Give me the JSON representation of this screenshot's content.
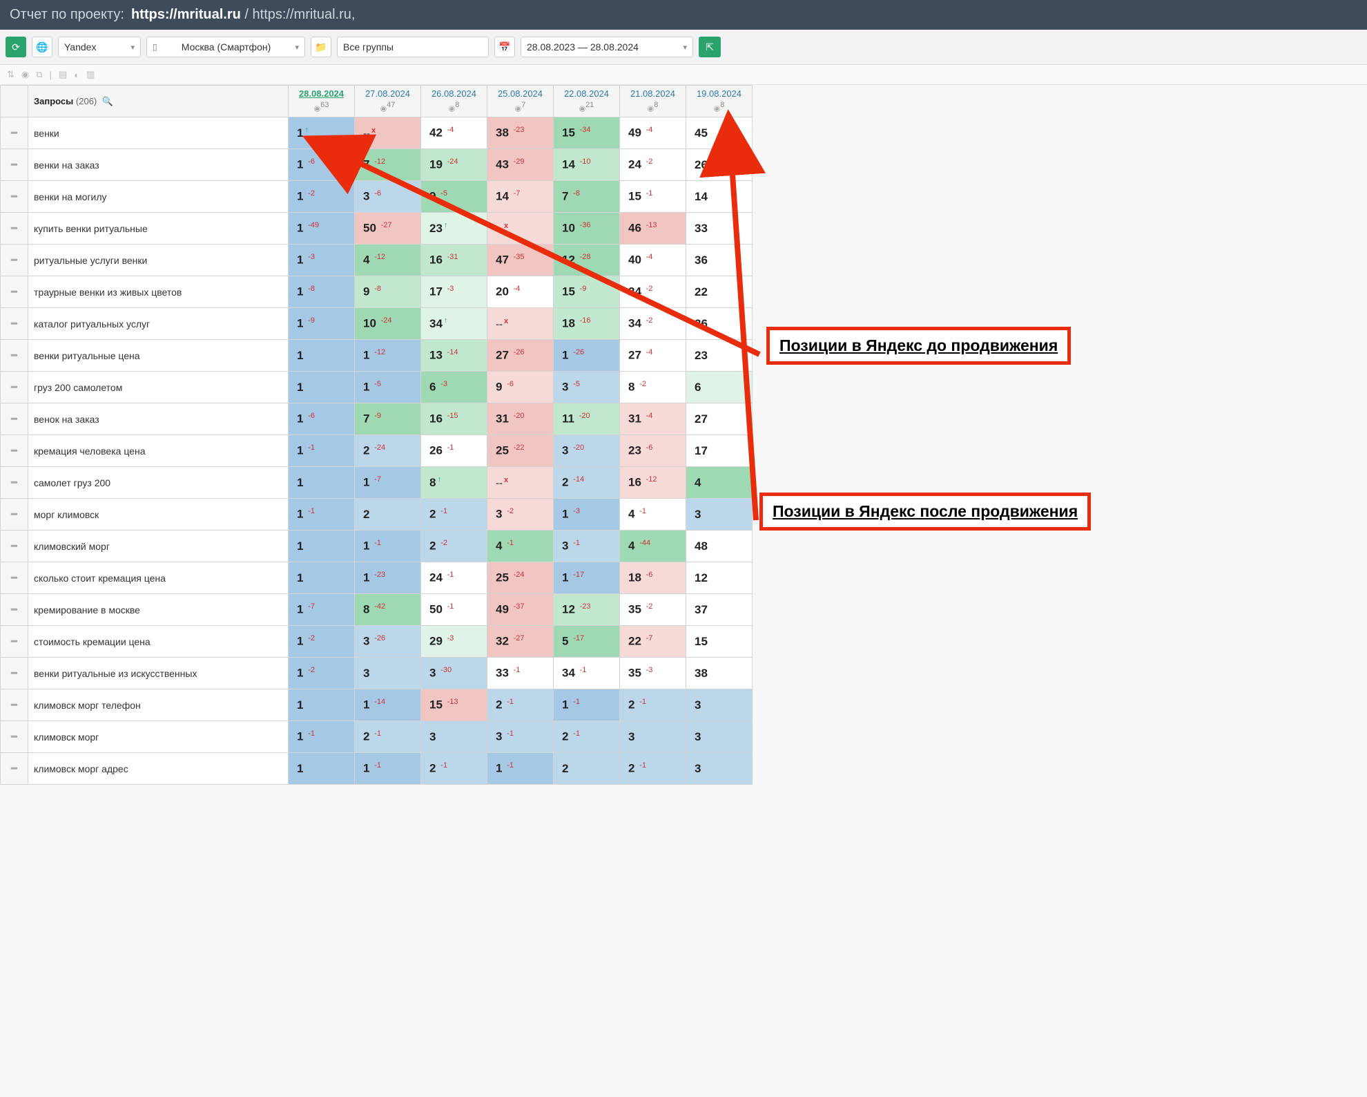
{
  "header": {
    "label": "Отчет по проекту:",
    "bold": "https://mritual.ru",
    "sep": " / ",
    "thin": "https://mritual.ru,"
  },
  "toolbar": {
    "searchengine": "Yandex",
    "region": "Москва (Смартфон)",
    "group": "Все группы",
    "daterange": "28.08.2023 — 28.08.2024"
  },
  "table": {
    "queries_label": "Запросы",
    "queries_count": "(206)"
  },
  "dates": [
    {
      "d": "28.08.2024",
      "sup": "63",
      "active": true
    },
    {
      "d": "27.08.2024",
      "sup": "47"
    },
    {
      "d": "26.08.2024",
      "sup": "8"
    },
    {
      "d": "25.08.2024",
      "sup": "7"
    },
    {
      "d": "22.08.2024",
      "sup": "21"
    },
    {
      "d": "21.08.2024",
      "sup": "8"
    },
    {
      "d": "19.08.2024",
      "sup": "8"
    }
  ],
  "callouts": {
    "before": "Позиции в Яндекс до продвижения",
    "after": "Позиции в Яндекс после продвижения"
  },
  "chart_data": {
    "type": "table",
    "columns": [
      "query",
      "28.08.2024",
      "27.08.2024",
      "26.08.2024",
      "25.08.2024",
      "22.08.2024",
      "21.08.2024",
      "19.08.2024"
    ],
    "rows": [
      {
        "q": "венки",
        "c": [
          {
            "v": "1",
            "d": "",
            "bg": "b1",
            "arrow": true
          },
          {
            "v": "",
            "d": "x",
            "bg": "r1",
            "dash": true
          },
          {
            "v": "42",
            "d": "-4",
            "bg": "w"
          },
          {
            "v": "38",
            "d": "-23",
            "bg": "r1"
          },
          {
            "v": "15",
            "d": "-34",
            "bg": "g1"
          },
          {
            "v": "49",
            "d": "-4",
            "bg": "w"
          },
          {
            "v": "45",
            "d": "",
            "bg": "w"
          }
        ]
      },
      {
        "q": "венки на заказ",
        "c": [
          {
            "v": "1",
            "d": "-6",
            "bg": "b1"
          },
          {
            "v": "7",
            "d": "-12",
            "bg": "g1"
          },
          {
            "v": "19",
            "d": "-24",
            "bg": "g2"
          },
          {
            "v": "43",
            "d": "-29",
            "bg": "r1"
          },
          {
            "v": "14",
            "d": "-10",
            "bg": "g2"
          },
          {
            "v": "24",
            "d": "-2",
            "bg": "w"
          },
          {
            "v": "26",
            "d": "",
            "bg": "w"
          }
        ]
      },
      {
        "q": "венки на могилу",
        "c": [
          {
            "v": "1",
            "d": "-2",
            "bg": "b1"
          },
          {
            "v": "3",
            "d": "-6",
            "bg": "b2"
          },
          {
            "v": "9",
            "d": "-5",
            "bg": "g1"
          },
          {
            "v": "14",
            "d": "-7",
            "bg": "r2"
          },
          {
            "v": "7",
            "d": "-8",
            "bg": "g1"
          },
          {
            "v": "15",
            "d": "-1",
            "bg": "w"
          },
          {
            "v": "14",
            "d": "",
            "bg": "w"
          }
        ]
      },
      {
        "q": "купить венки ритуальные",
        "c": [
          {
            "v": "1",
            "d": "-49",
            "bg": "b1"
          },
          {
            "v": "50",
            "d": "-27",
            "bg": "r1"
          },
          {
            "v": "23",
            "d": "",
            "bg": "g3",
            "arrow": true
          },
          {
            "v": "--",
            "d": "x",
            "bg": "r2",
            "dash": true
          },
          {
            "v": "10",
            "d": "-36",
            "bg": "g1"
          },
          {
            "v": "46",
            "d": "-13",
            "bg": "r1"
          },
          {
            "v": "33",
            "d": "",
            "bg": "w"
          }
        ]
      },
      {
        "q": "ритуальные услуги венки",
        "c": [
          {
            "v": "1",
            "d": "-3",
            "bg": "b1"
          },
          {
            "v": "4",
            "d": "-12",
            "bg": "g1"
          },
          {
            "v": "16",
            "d": "-31",
            "bg": "g2"
          },
          {
            "v": "47",
            "d": "-35",
            "bg": "r1"
          },
          {
            "v": "12",
            "d": "-28",
            "bg": "g1"
          },
          {
            "v": "40",
            "d": "-4",
            "bg": "w"
          },
          {
            "v": "36",
            "d": "",
            "bg": "w"
          }
        ]
      },
      {
        "q": "траурные венки из живых цветов",
        "c": [
          {
            "v": "1",
            "d": "-8",
            "bg": "b1"
          },
          {
            "v": "9",
            "d": "-8",
            "bg": "g2"
          },
          {
            "v": "17",
            "d": "-3",
            "bg": "g3"
          },
          {
            "v": "20",
            "d": "-4",
            "bg": "w"
          },
          {
            "v": "15",
            "d": "-9",
            "bg": "g2"
          },
          {
            "v": "24",
            "d": "-2",
            "bg": "w"
          },
          {
            "v": "22",
            "d": "",
            "bg": "w"
          }
        ]
      },
      {
        "q": "каталог ритуальных услуг",
        "c": [
          {
            "v": "1",
            "d": "-9",
            "bg": "b1"
          },
          {
            "v": "10",
            "d": "-24",
            "bg": "g1"
          },
          {
            "v": "34",
            "d": "",
            "bg": "g3",
            "arrow": true
          },
          {
            "v": "--",
            "d": "x",
            "bg": "r2",
            "dash": true
          },
          {
            "v": "18",
            "d": "-16",
            "bg": "g2"
          },
          {
            "v": "34",
            "d": "-2",
            "bg": "w"
          },
          {
            "v": "36",
            "d": "",
            "bg": "w"
          }
        ]
      },
      {
        "q": "венки ритуальные цена",
        "c": [
          {
            "v": "1",
            "d": "",
            "bg": "b1"
          },
          {
            "v": "1",
            "d": "-12",
            "bg": "b1"
          },
          {
            "v": "13",
            "d": "-14",
            "bg": "g2"
          },
          {
            "v": "27",
            "d": "-26",
            "bg": "r1"
          },
          {
            "v": "1",
            "d": "-26",
            "bg": "b1"
          },
          {
            "v": "27",
            "d": "-4",
            "bg": "w"
          },
          {
            "v": "23",
            "d": "",
            "bg": "w"
          }
        ]
      },
      {
        "q": "груз 200 самолетом",
        "c": [
          {
            "v": "1",
            "d": "",
            "bg": "b1"
          },
          {
            "v": "1",
            "d": "-5",
            "bg": "b1"
          },
          {
            "v": "6",
            "d": "-3",
            "bg": "g1"
          },
          {
            "v": "9",
            "d": "-6",
            "bg": "r2"
          },
          {
            "v": "3",
            "d": "-5",
            "bg": "b2"
          },
          {
            "v": "8",
            "d": "-2",
            "bg": "w"
          },
          {
            "v": "6",
            "d": "",
            "bg": "g3"
          }
        ]
      },
      {
        "q": "венок на заказ",
        "c": [
          {
            "v": "1",
            "d": "-6",
            "bg": "b1"
          },
          {
            "v": "7",
            "d": "-9",
            "bg": "g1"
          },
          {
            "v": "16",
            "d": "-15",
            "bg": "g2"
          },
          {
            "v": "31",
            "d": "-20",
            "bg": "r1"
          },
          {
            "v": "11",
            "d": "-20",
            "bg": "g2"
          },
          {
            "v": "31",
            "d": "-4",
            "bg": "r2"
          },
          {
            "v": "27",
            "d": "",
            "bg": "w"
          }
        ]
      },
      {
        "q": "кремация человека цена",
        "c": [
          {
            "v": "1",
            "d": "-1",
            "bg": "b1"
          },
          {
            "v": "2",
            "d": "-24",
            "bg": "b2"
          },
          {
            "v": "26",
            "d": "-1",
            "bg": "w"
          },
          {
            "v": "25",
            "d": "-22",
            "bg": "r1"
          },
          {
            "v": "3",
            "d": "-20",
            "bg": "b2"
          },
          {
            "v": "23",
            "d": "-6",
            "bg": "r2"
          },
          {
            "v": "17",
            "d": "",
            "bg": "w"
          }
        ]
      },
      {
        "q": "самолет груз 200",
        "c": [
          {
            "v": "1",
            "d": "",
            "bg": "b1"
          },
          {
            "v": "1",
            "d": "-7",
            "bg": "b1"
          },
          {
            "v": "8",
            "d": "",
            "bg": "g2",
            "arrow": true
          },
          {
            "v": "--",
            "d": "x",
            "bg": "r2",
            "dash": true
          },
          {
            "v": "2",
            "d": "-14",
            "bg": "b2"
          },
          {
            "v": "16",
            "d": "-12",
            "bg": "r2"
          },
          {
            "v": "4",
            "d": "",
            "bg": "g1"
          }
        ]
      },
      {
        "q": "морг климовск",
        "c": [
          {
            "v": "1",
            "d": "-1",
            "bg": "b1"
          },
          {
            "v": "2",
            "d": "",
            "bg": "b2"
          },
          {
            "v": "2",
            "d": "-1",
            "bg": "b2"
          },
          {
            "v": "3",
            "d": "-2",
            "bg": "r2"
          },
          {
            "v": "1",
            "d": "-3",
            "bg": "b1"
          },
          {
            "v": "4",
            "d": "-1",
            "bg": "w"
          },
          {
            "v": "3",
            "d": "",
            "bg": "b2"
          }
        ]
      },
      {
        "q": "климовский морг",
        "c": [
          {
            "v": "1",
            "d": "",
            "bg": "b1"
          },
          {
            "v": "1",
            "d": "-1",
            "bg": "b1"
          },
          {
            "v": "2",
            "d": "-2",
            "bg": "b2"
          },
          {
            "v": "4",
            "d": "-1",
            "bg": "g1"
          },
          {
            "v": "3",
            "d": "-1",
            "bg": "b2"
          },
          {
            "v": "4",
            "d": "-44",
            "bg": "g1"
          },
          {
            "v": "48",
            "d": "",
            "bg": "w"
          }
        ]
      },
      {
        "q": "сколько стоит кремация цена",
        "c": [
          {
            "v": "1",
            "d": "",
            "bg": "b1"
          },
          {
            "v": "1",
            "d": "-23",
            "bg": "b1"
          },
          {
            "v": "24",
            "d": "-1",
            "bg": "w"
          },
          {
            "v": "25",
            "d": "-24",
            "bg": "r1"
          },
          {
            "v": "1",
            "d": "-17",
            "bg": "b1"
          },
          {
            "v": "18",
            "d": "-6",
            "bg": "r2"
          },
          {
            "v": "12",
            "d": "",
            "bg": "w"
          }
        ]
      },
      {
        "q": "кремирование в москве",
        "c": [
          {
            "v": "1",
            "d": "-7",
            "bg": "b1"
          },
          {
            "v": "8",
            "d": "-42",
            "bg": "g1"
          },
          {
            "v": "50",
            "d": "-1",
            "bg": "w"
          },
          {
            "v": "49",
            "d": "-37",
            "bg": "r1"
          },
          {
            "v": "12",
            "d": "-23",
            "bg": "g2"
          },
          {
            "v": "35",
            "d": "-2",
            "bg": "w"
          },
          {
            "v": "37",
            "d": "",
            "bg": "w"
          }
        ]
      },
      {
        "q": "стоимость кремации цена",
        "c": [
          {
            "v": "1",
            "d": "-2",
            "bg": "b1"
          },
          {
            "v": "3",
            "d": "-26",
            "bg": "b2"
          },
          {
            "v": "29",
            "d": "-3",
            "bg": "g3"
          },
          {
            "v": "32",
            "d": "-27",
            "bg": "r1"
          },
          {
            "v": "5",
            "d": "-17",
            "bg": "g1"
          },
          {
            "v": "22",
            "d": "-7",
            "bg": "r2"
          },
          {
            "v": "15",
            "d": "",
            "bg": "w"
          }
        ]
      },
      {
        "q": "венки ритуальные из искусственных",
        "c": [
          {
            "v": "1",
            "d": "-2",
            "bg": "b1"
          },
          {
            "v": "3",
            "d": "",
            "bg": "b2"
          },
          {
            "v": "3",
            "d": "-30",
            "bg": "b2"
          },
          {
            "v": "33",
            "d": "-1",
            "bg": "w"
          },
          {
            "v": "34",
            "d": "-1",
            "bg": "w"
          },
          {
            "v": "35",
            "d": "-3",
            "bg": "w"
          },
          {
            "v": "38",
            "d": "",
            "bg": "w"
          }
        ]
      },
      {
        "q": "климовск морг телефон",
        "c": [
          {
            "v": "1",
            "d": "",
            "bg": "b1"
          },
          {
            "v": "1",
            "d": "-14",
            "bg": "b1"
          },
          {
            "v": "15",
            "d": "-13",
            "bg": "r1"
          },
          {
            "v": "2",
            "d": "-1",
            "bg": "b2"
          },
          {
            "v": "1",
            "d": "-1",
            "bg": "b1"
          },
          {
            "v": "2",
            "d": "-1",
            "bg": "b2"
          },
          {
            "v": "3",
            "d": "",
            "bg": "b2"
          }
        ]
      },
      {
        "q": "климовск морг",
        "c": [
          {
            "v": "1",
            "d": "-1",
            "bg": "b1"
          },
          {
            "v": "2",
            "d": "-1",
            "bg": "b2"
          },
          {
            "v": "3",
            "d": "",
            "bg": "b2"
          },
          {
            "v": "3",
            "d": "-1",
            "bg": "b2"
          },
          {
            "v": "2",
            "d": "-1",
            "bg": "b2"
          },
          {
            "v": "3",
            "d": "",
            "bg": "b2"
          },
          {
            "v": "3",
            "d": "",
            "bg": "b2"
          }
        ]
      },
      {
        "q": "климовск морг адрес",
        "c": [
          {
            "v": "1",
            "d": "",
            "bg": "b1"
          },
          {
            "v": "1",
            "d": "-1",
            "bg": "b1"
          },
          {
            "v": "2",
            "d": "-1",
            "bg": "b2"
          },
          {
            "v": "1",
            "d": "-1",
            "bg": "b1"
          },
          {
            "v": "2",
            "d": "",
            "bg": "b2"
          },
          {
            "v": "2",
            "d": "-1",
            "bg": "b2"
          },
          {
            "v": "3",
            "d": "",
            "bg": "b2"
          }
        ]
      }
    ]
  }
}
